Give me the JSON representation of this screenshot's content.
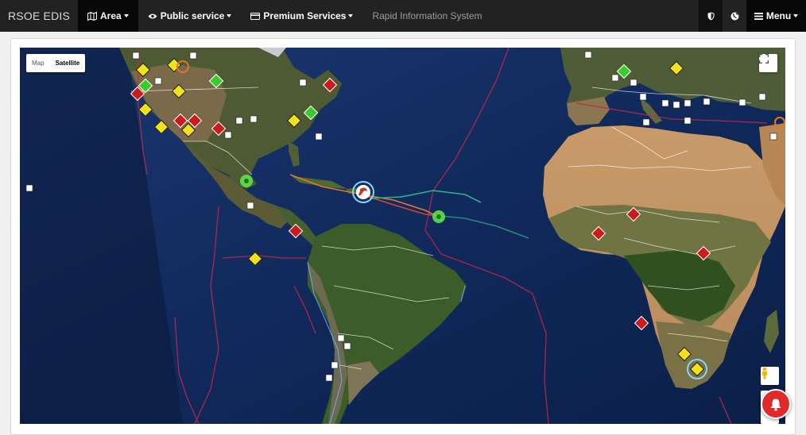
{
  "navbar": {
    "brand": "RSOE EDIS",
    "area_label": "Area",
    "public_label": "Public service",
    "premium_label": "Premium Services",
    "subtitle": "Rapid Information System",
    "menu_label": "Menu",
    "icons": [
      "map-icon",
      "eye-icon",
      "card-icon",
      "shield-icon",
      "globe-icon",
      "bars-icon"
    ]
  },
  "map": {
    "type_map": "Map",
    "type_satellite": "Satellite",
    "selected_type": "Satellite",
    "event_colors": {
      "red": "#cc1b1b",
      "yellow": "#f2e21e",
      "green": "#3ccb2e",
      "orange": "#e8742a",
      "storm": "#7fd8ff"
    }
  },
  "controls": [
    "fullscreen-icon",
    "pegman-icon",
    "bell-icon"
  ]
}
